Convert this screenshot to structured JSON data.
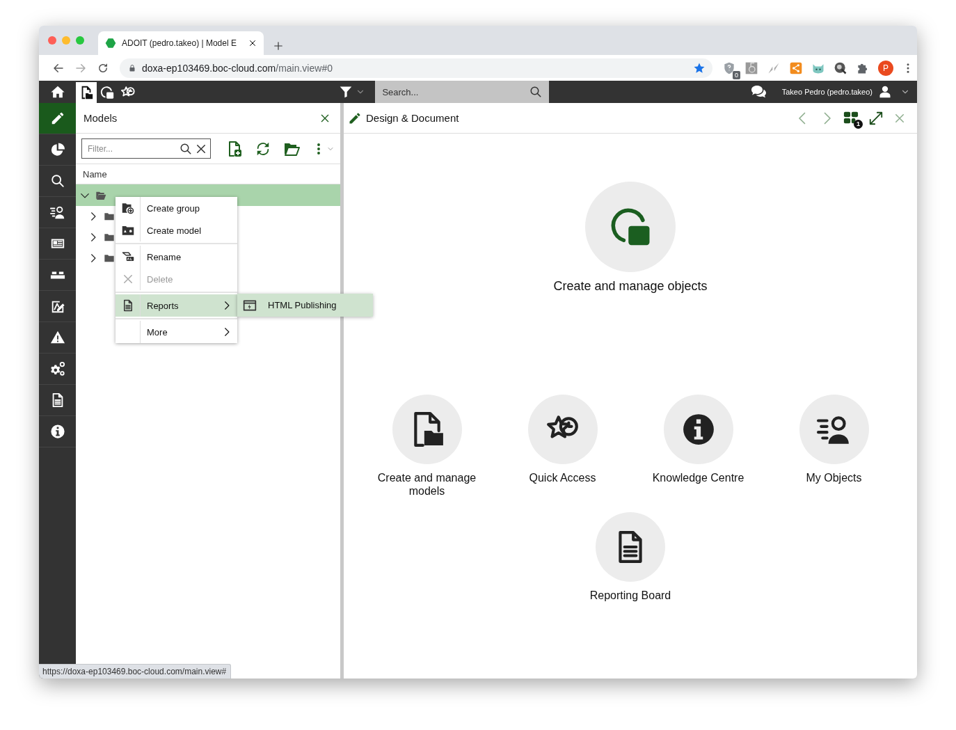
{
  "browser": {
    "tab_title": "ADOIT (pedro.takeo) | Model E",
    "url_host": "doxa-ep103469.boc-cloud.com",
    "url_path": "/main.view#0",
    "bookmarked": true,
    "extension_badge": "0",
    "profile_initial": "P"
  },
  "app_bar": {
    "tabs": [
      {
        "selected": true
      },
      {
        "selected": false
      },
      {
        "selected": false
      }
    ],
    "search": {
      "placeholder": "Search..."
    },
    "user": "Takeo Pedro (pedro.takeo)"
  },
  "sidebar": {
    "items": [
      {
        "selected": true
      },
      {
        "selected": false
      },
      {
        "selected": false
      },
      {
        "selected": false
      },
      {
        "selected": false
      },
      {
        "selected": false
      },
      {
        "selected": false
      },
      {
        "selected": false
      },
      {
        "selected": false
      },
      {
        "selected": false
      },
      {
        "selected": false
      }
    ]
  },
  "models_panel": {
    "title": "Models",
    "filter": {
      "placeholder": "Filter..."
    },
    "column": "Name",
    "tree": [
      {
        "selected": true,
        "expanded": true,
        "children": [
          {
            "expanded": false
          },
          {
            "expanded": false
          },
          {
            "expanded": false
          }
        ]
      }
    ]
  },
  "context_menu": {
    "items": [
      {
        "kind": "item",
        "label": "Create group",
        "disabled": false,
        "selected": false,
        "submenu": false
      },
      {
        "kind": "item",
        "label": "Create model",
        "disabled": false,
        "selected": false,
        "submenu": false
      },
      {
        "kind": "separator"
      },
      {
        "kind": "item",
        "label": "Rename",
        "disabled": false,
        "selected": false,
        "submenu": false
      },
      {
        "kind": "item",
        "label": "Delete",
        "disabled": true,
        "selected": false,
        "submenu": false
      },
      {
        "kind": "separator"
      },
      {
        "kind": "item",
        "label": "Reports",
        "disabled": false,
        "selected": true,
        "submenu": true
      },
      {
        "kind": "separator"
      },
      {
        "kind": "item",
        "label": "More",
        "disabled": false,
        "selected": false,
        "submenu": true
      }
    ],
    "submenu": {
      "items": [
        {
          "label": "HTML Publishing",
          "selected": true
        }
      ]
    }
  },
  "design_panel": {
    "title": "Design & Document",
    "nav": [
      {
        "disabled": true
      },
      {
        "disabled": true
      },
      {
        "disabled": false,
        "badge": "1"
      },
      {
        "disabled": false
      },
      {
        "disabled": true
      }
    ],
    "tile_rows": [
      {
        "tiles": [
          {
            "kind": "featured",
            "label": "Create and manage objects"
          }
        ]
      },
      {
        "tiles": [
          {
            "kind": "standard",
            "label": "Create and manage models"
          },
          {
            "kind": "standard",
            "label": "Quick Access"
          },
          {
            "kind": "standard",
            "label": "Knowledge Centre"
          },
          {
            "kind": "standard",
            "label": "My Objects"
          }
        ]
      },
      {
        "tiles": [
          {
            "kind": "standard",
            "label": "Reporting Board"
          }
        ]
      }
    ]
  },
  "status_url": "https://doxa-ep103469.boc-cloud.com/main.view#"
}
